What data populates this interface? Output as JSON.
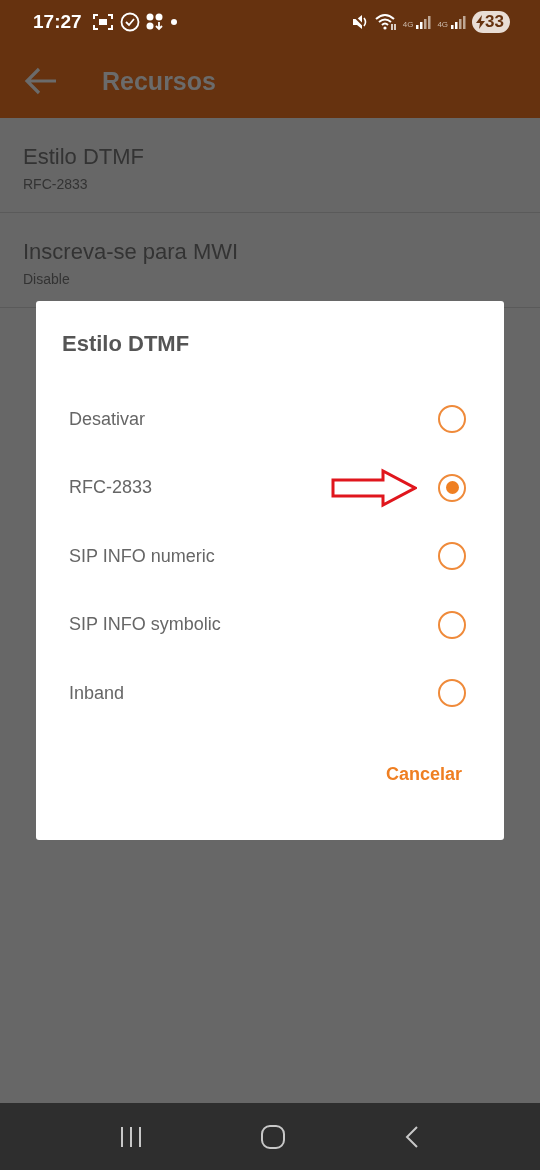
{
  "status_bar": {
    "time": "17:27",
    "network_labels": [
      "4G",
      "4G"
    ],
    "battery": "33"
  },
  "app_bar": {
    "title": "Recursos"
  },
  "settings": [
    {
      "title": "Estilo DTMF",
      "summary": "RFC-2833"
    },
    {
      "title": "Inscreva-se para MWI",
      "summary": "Disable"
    }
  ],
  "dialog": {
    "title": "Estilo DTMF",
    "options": [
      {
        "label": "Desativar",
        "selected": false,
        "annotated": false
      },
      {
        "label": "RFC-2833",
        "selected": true,
        "annotated": true
      },
      {
        "label": "SIP INFO numeric",
        "selected": false,
        "annotated": false
      },
      {
        "label": "SIP INFO symbolic",
        "selected": false,
        "annotated": false
      },
      {
        "label": "Inband",
        "selected": false,
        "annotated": false
      }
    ],
    "buttons": [
      "Cancelar"
    ]
  }
}
